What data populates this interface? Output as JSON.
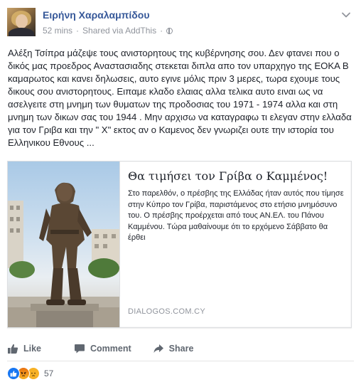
{
  "post": {
    "author": "Ειρήνη Χαραλαμπίδου",
    "timestamp": "52 mins",
    "via": "Shared via AddThis",
    "separator": "·",
    "privacy_icon": "globe-icon",
    "text": "Αλέξη Τσίπρα μάζεψε τους ανιστορητους της κυβέρνησης σου. Δεν φτανει που ο δικός μας προεδρος Αναστασιαδης στεκεται διπλα απο τον υπαρχηγο της ΕΟΚΑ Β καμαρωτος και κανει δηλωσεις, αυτο εγινε μόλις πριν 3 μερες, τωρα εχουμε τους δικους σου ανιστορητους. Ειπαμε κλαδο ελαιας αλλα τελικα αυτο ειναι ως να ασελγειτε στη μνημη των θυματων της προδοσιας του 1971 - 1974 αλλα και στη μνημη των δικων σας του 1944 . Μην αρχισω να καταγραφω τι ελεγαν στην ελλαδα για τον Γριβα και την \" Χ\" εκτος αν ο Καμενος δεν γνωριζει ουτε την ιστορία του Ελληνικου Εθνους ..."
  },
  "link_card": {
    "title": "Θα τιμήσει τον Γρίβα ο Καμμένος!",
    "description": "Στο παρελθόν, ο πρέσβης της Ελλάδας ήταν αυτός που τίμησε στην Κύπρο τον Γρίβα, παριστάμενος στο ετήσιο μνημόσυνο του. Ο πρέσβης προέρχεται από τους ΑΝ.ΕΛ. του Πάνου Καμμένου. Τώρα μαθαίνουμε ότι το ερχόμενο Σάββατο θα έρθει",
    "domain": "DIALOGOS.COM.CY"
  },
  "actions": {
    "like": "Like",
    "comment": "Comment",
    "share": "Share"
  },
  "reactions": {
    "types": [
      "like",
      "angry",
      "sad"
    ],
    "count": "57"
  },
  "colors": {
    "author": "#365899",
    "meta": "#90949c",
    "action_text": "#606770",
    "like_blue": "#1877f2",
    "border": "#dddfe2"
  }
}
